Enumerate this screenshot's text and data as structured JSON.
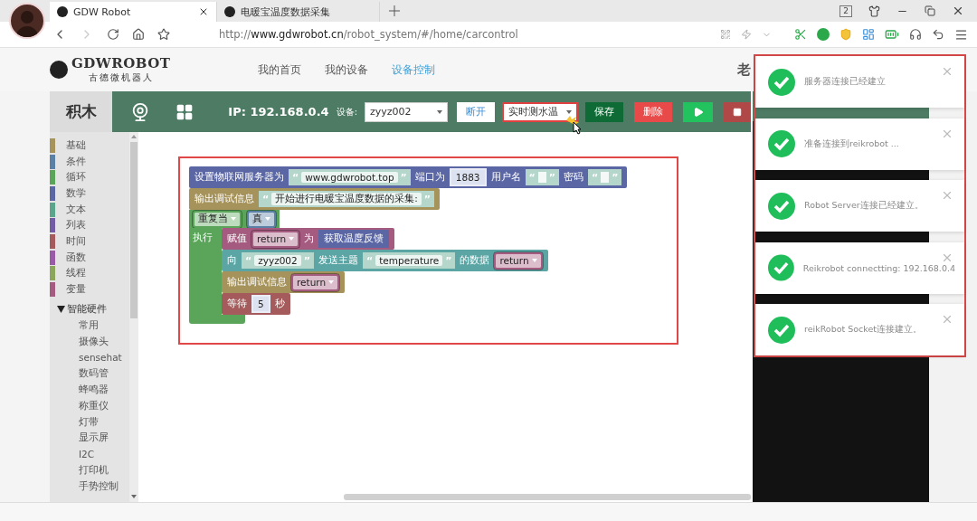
{
  "browser": {
    "tabs": [
      {
        "title": "GDW Robot",
        "selected": true
      },
      {
        "title": "电暖宝温度数据采集",
        "selected": false
      }
    ],
    "window_badge": "2",
    "url": "http://**www.gdwrobot.cn**/robot_system/#/home/carcontrol"
  },
  "site": {
    "logo": {
      "name": "GDWROBOT",
      "subtitle": "古德微机器人"
    },
    "nav": [
      {
        "label": "我的首页",
        "selected": false
      },
      {
        "label": "我的设备",
        "selected": false
      },
      {
        "label": "设备控制",
        "selected": true
      }
    ],
    "user": "老"
  },
  "editor": {
    "title": "积木",
    "categories": [
      {
        "label": "基础",
        "color": "#a5935b"
      },
      {
        "label": "条件",
        "color": "#5b80a5"
      },
      {
        "label": "循环",
        "color": "#5ba55b"
      },
      {
        "label": "数学",
        "color": "#5b67a5"
      },
      {
        "label": "文本",
        "color": "#5ba58c"
      },
      {
        "label": "列表",
        "color": "#745ba5"
      },
      {
        "label": "时间",
        "color": "#a55b5b"
      },
      {
        "label": "函数",
        "color": "#995ba5"
      },
      {
        "label": "线程",
        "color": "#8ba55b"
      },
      {
        "label": "变量",
        "color": "#a55b80"
      }
    ],
    "hardware": {
      "label": "智能硬件",
      "expanded": true,
      "children": [
        {
          "label": "常用"
        },
        {
          "label": "摄像头"
        },
        {
          "label": "sensehat"
        },
        {
          "label": "数码管"
        },
        {
          "label": "蜂鸣器"
        },
        {
          "label": "称重仪"
        },
        {
          "label": "灯带"
        },
        {
          "label": "显示屏"
        },
        {
          "label": "I2C"
        },
        {
          "label": "打印机"
        },
        {
          "label": "手势控制"
        }
      ]
    }
  },
  "toolbar": {
    "ip": "IP: 192.168.0.4",
    "device_label": "设备:",
    "device": "zyyz002",
    "buttons": [
      {
        "kind": "disconnect",
        "label": "断开"
      },
      {
        "kind": "select",
        "label": "实时测水温",
        "highlighted": true
      },
      {
        "kind": "save",
        "label": "保存"
      },
      {
        "kind": "delete",
        "label": "删除"
      },
      {
        "kind": "run"
      },
      {
        "kind": "stop"
      }
    ]
  },
  "workspace": {
    "highlighted": true,
    "blocks": [
      {
        "kind": "statement",
        "color": "#5b67a5",
        "parts": [
          {
            "kind": "label",
            "text": "设置物联网服务器为"
          },
          {
            "kind": "string",
            "open": "“",
            "text": "www.gdwrobot.top",
            "close": "”"
          },
          {
            "kind": "label",
            "text": "端口为"
          },
          {
            "kind": "number",
            "text": "1883"
          },
          {
            "kind": "label",
            "text": "用户名"
          },
          {
            "kind": "string",
            "open": "“",
            "close": "”"
          },
          {
            "kind": "label",
            "text": "密码"
          },
          {
            "kind": "string",
            "open": "“",
            "close": "”"
          }
        ]
      },
      {
        "kind": "statement",
        "color": "#a5935b",
        "parts": [
          {
            "kind": "label",
            "text": "输出调试信息"
          },
          {
            "kind": "string",
            "open": "“",
            "text": "开始进行电暖宝温度数据的采集:",
            "close": "”"
          }
        ]
      },
      {
        "kind": "loop",
        "color": "#5ba55b",
        "head": [
          {
            "kind": "dropdown",
            "text": "重复当",
            "color": "#5ba55b"
          },
          {
            "kind": "dropdown",
            "text": "真",
            "color": "#5b80a5"
          }
        ],
        "body_label": "执行",
        "children": [
          {
            "kind": "statement",
            "color": "#a55b80",
            "parts": [
              {
                "kind": "label",
                "text": "赋值"
              },
              {
                "kind": "dropdown",
                "text": "return",
                "color": "#a55b80"
              },
              {
                "kind": "label",
                "text": "为"
              },
              {
                "kind": "block",
                "text": "获取温度反馈",
                "color": "#5b67a5"
              }
            ]
          },
          {
            "kind": "statement",
            "color": "#5ba5a5",
            "parts": [
              {
                "kind": "label",
                "text": "向"
              },
              {
                "kind": "string",
                "open": "“",
                "text": "zyyz002",
                "close": "”"
              },
              {
                "kind": "label",
                "text": "发送主题"
              },
              {
                "kind": "string",
                "open": "“",
                "text": "temperature",
                "close": "”"
              },
              {
                "kind": "label",
                "text": "的数据"
              },
              {
                "kind": "dropdown",
                "text": "return",
                "color": "#a55b80"
              }
            ]
          },
          {
            "kind": "statement",
            "color": "#a5935b",
            "parts": [
              {
                "kind": "label",
                "text": "输出调试信息"
              },
              {
                "kind": "dropdown",
                "text": "return",
                "color": "#a55b80"
              }
            ]
          },
          {
            "kind": "statement",
            "color": "#a55b5b",
            "parts": [
              {
                "kind": "label",
                "text": "等待"
              },
              {
                "kind": "number",
                "text": "5"
              },
              {
                "kind": "label",
                "text": "秒"
              }
            ]
          }
        ]
      }
    ]
  },
  "toasts": [
    {
      "text": "服务器连接已经建立"
    },
    {
      "text": "准备连接到reikrobot ..."
    },
    {
      "text": "Robot Server连接已经建立。"
    },
    {
      "text": "Reikrobot connectting: 192.168.0.4"
    },
    {
      "text": "reikRobot Socket连接建立。"
    }
  ]
}
